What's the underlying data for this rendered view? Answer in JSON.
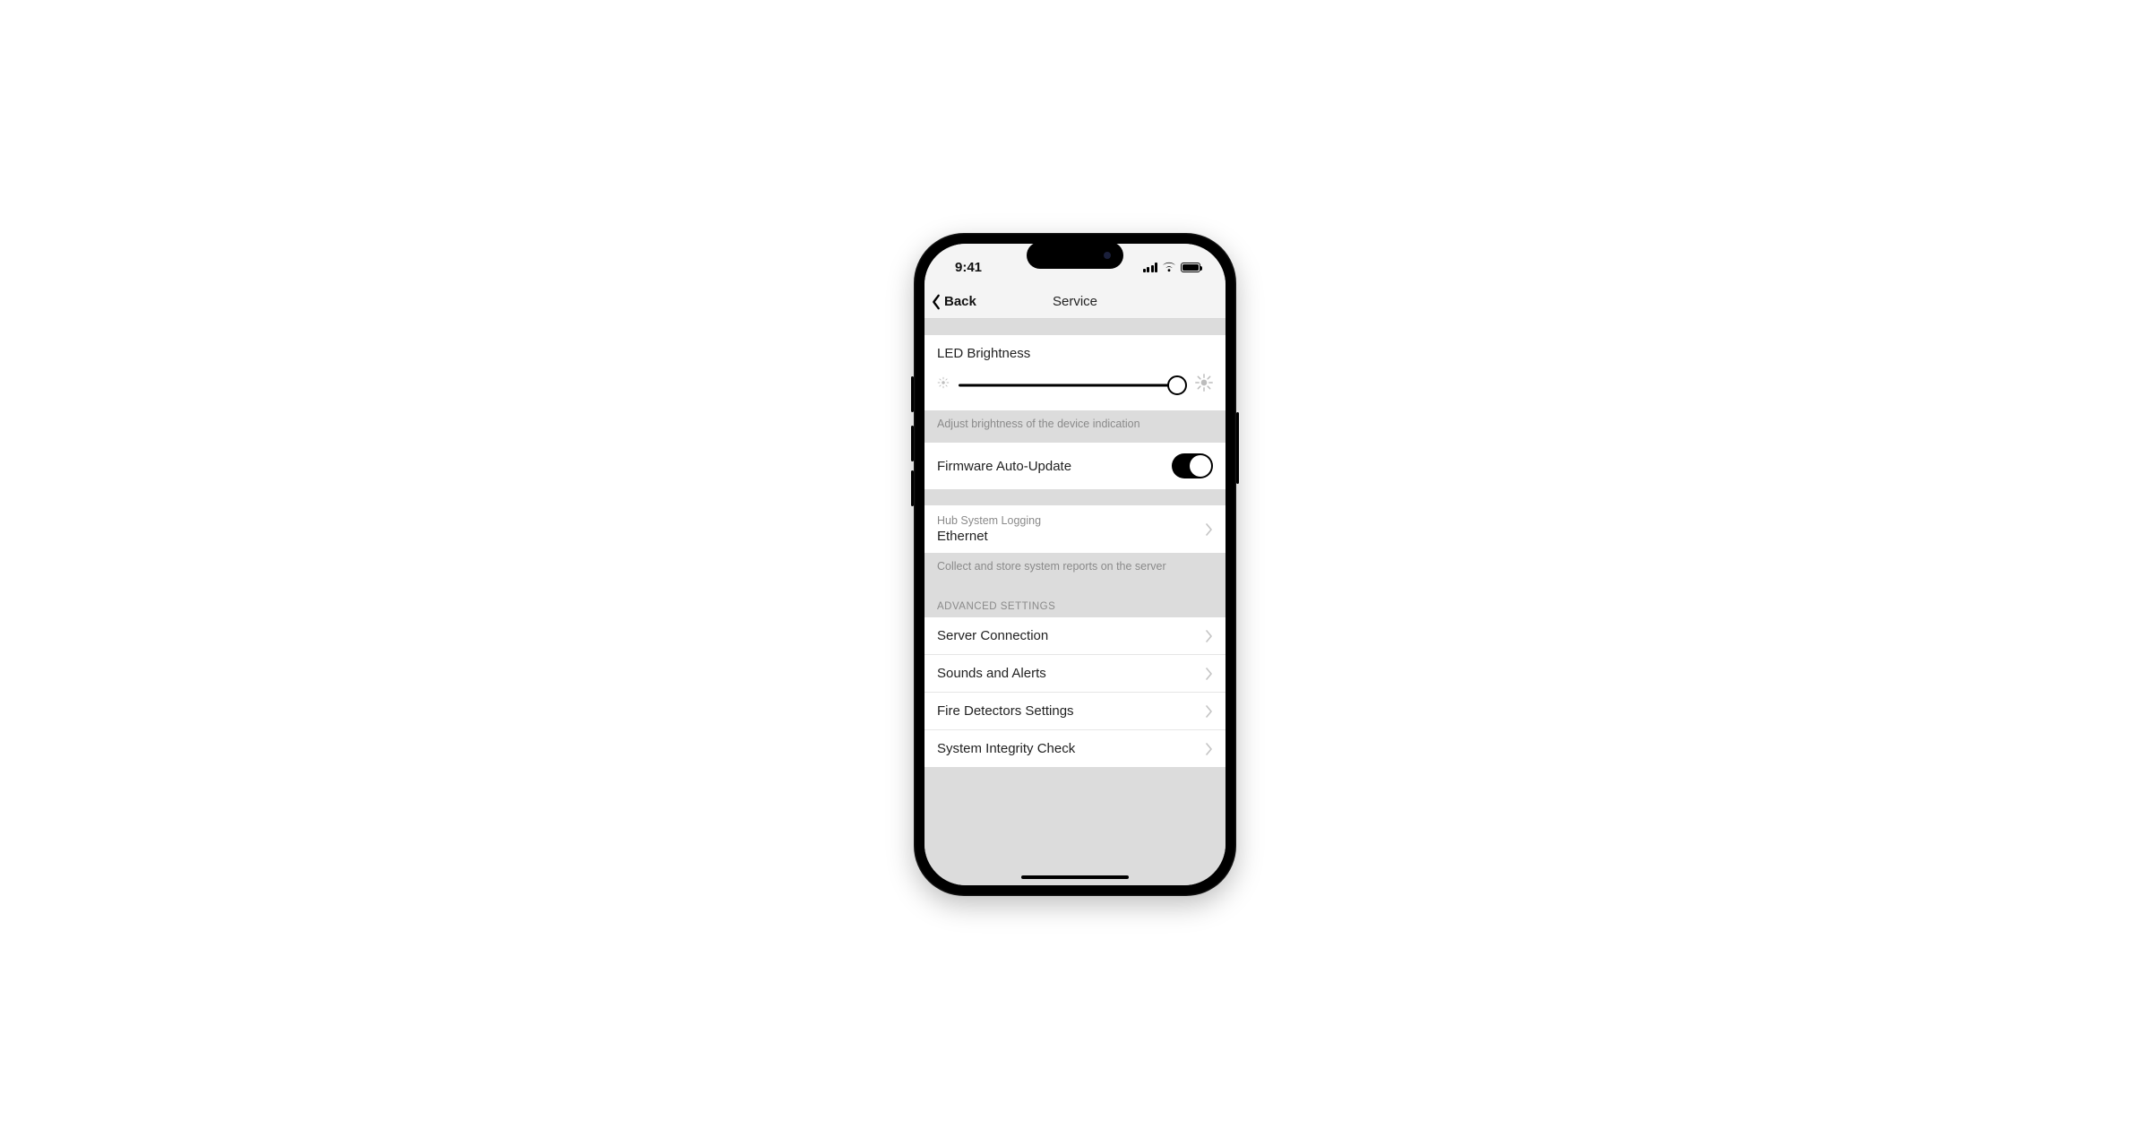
{
  "status": {
    "time": "9:41"
  },
  "nav": {
    "back": "Back",
    "title": "Service"
  },
  "brightness": {
    "title": "LED Brightness",
    "footer": "Adjust brightness of the device indication"
  },
  "firmware": {
    "label": "Firmware Auto-Update",
    "on": true
  },
  "logging": {
    "label": "Hub System Logging",
    "value": "Ethernet",
    "footer": "Collect and store system reports on the server"
  },
  "advanced": {
    "header": "ADVANCED SETTINGS",
    "items": [
      "Server Connection",
      "Sounds and Alerts",
      "Fire Detectors Settings",
      "System Integrity Check"
    ]
  }
}
